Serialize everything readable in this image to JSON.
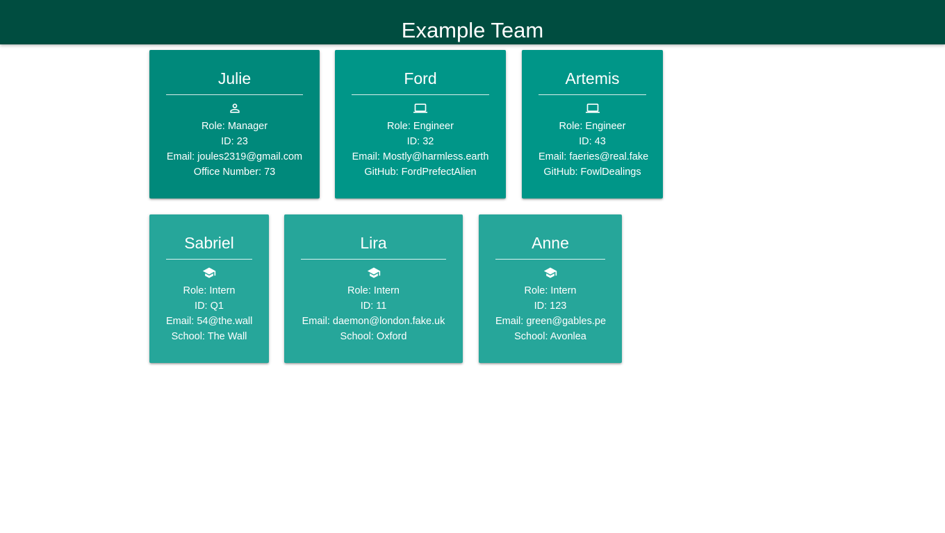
{
  "header": {
    "title": "Example Team"
  },
  "colors": {
    "header_bg": "#004d40",
    "manager_card": "#00897b",
    "engineer_card": "#009688",
    "intern_card": "#26a69a",
    "text": "#ffffff"
  },
  "cards": [
    {
      "name": "Julie",
      "icon": "person-icon",
      "role": "Role: Manager",
      "id": "ID: 23",
      "email": "Email: joules2319@gmail.com",
      "extra": "Office Number: 73"
    },
    {
      "name": "Ford",
      "icon": "laptop-icon",
      "role": "Role: Engineer",
      "id": "ID: 32",
      "email": "Email: Mostly@harmless.earth",
      "extra": "GitHub: FordPrefectAlien"
    },
    {
      "name": "Artemis",
      "icon": "laptop-icon",
      "role": "Role: Engineer",
      "id": "ID: 43",
      "email": "Email: faeries@real.fake",
      "extra": "GitHub: FowlDealings"
    },
    {
      "name": "Sabriel",
      "icon": "graduation-cap-icon",
      "role": "Role: Intern",
      "id": "ID: Q1",
      "email": "Email: 54@the.wall",
      "extra": "School: The Wall"
    },
    {
      "name": "Lira",
      "icon": "graduation-cap-icon",
      "role": "Role: Intern",
      "id": "ID: 11",
      "email": "Email: daemon@london.fake.uk",
      "extra": "School: Oxford"
    },
    {
      "name": "Anne",
      "icon": "graduation-cap-icon",
      "role": "Role: Intern",
      "id": "ID: 123",
      "email": "Email: green@gables.pe",
      "extra": "School: Avonlea"
    }
  ]
}
